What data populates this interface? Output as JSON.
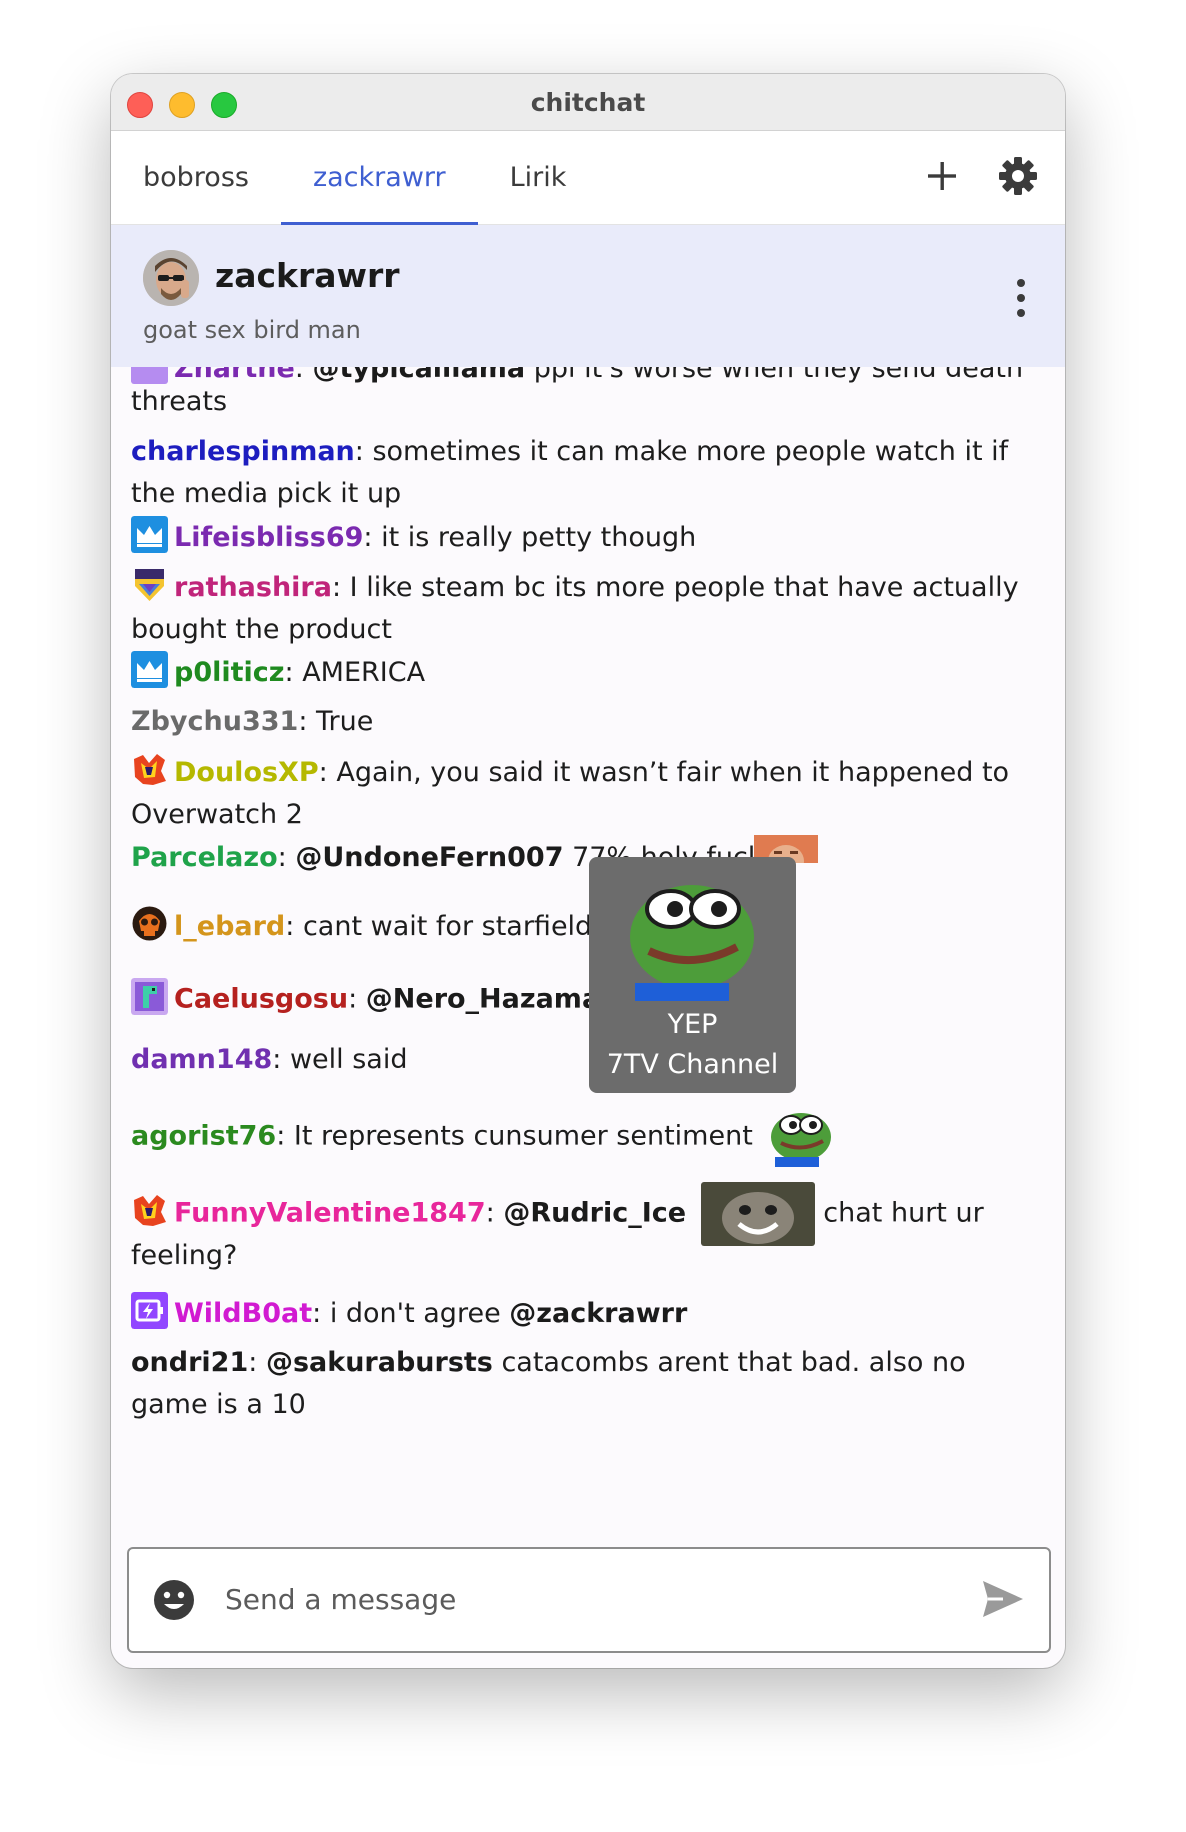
{
  "window": {
    "title": "chitchat"
  },
  "tabs": [
    {
      "label": "bobross",
      "active": false
    },
    {
      "label": "zackrawrr",
      "active": true
    },
    {
      "label": "Lirik",
      "active": false
    }
  ],
  "tab_actions": {
    "add_icon": "plus-icon",
    "settings_icon": "gear-icon"
  },
  "channel": {
    "name": "zackrawrr",
    "status": "goat sex bird man"
  },
  "messages": [
    {
      "user": "Znarthe",
      "sep": ":",
      "mention": "@typicalllama",
      "text": " ppl it's worse when they send death"
    },
    {
      "text": "threats"
    },
    {
      "user": "charlespinman",
      "sep": ":",
      "text": " sometimes it can make more people watch it if the media pick it up"
    },
    {
      "user": "Lifeisbliss69",
      "sep": ":",
      "text": " it is really petty though"
    },
    {
      "user": "rathashira",
      "sep": ":",
      "text": " I like steam bc its more people that have actually bought the product"
    },
    {
      "user": "p0liticz",
      "sep": ":",
      "text": " AMERICA"
    },
    {
      "user": "Zbychu331",
      "sep": ":",
      "text": " True"
    },
    {
      "user": "DoulosXP",
      "sep": ":",
      "text": " Again, you said it wasn’t fair when it happened to Overwatch 2"
    },
    {
      "user": "Parcelazo",
      "sep": ":",
      "mention": "@UndoneFern007",
      "text": " 77% holy fuck"
    },
    {
      "user": "l_ebard",
      "sep": ":",
      "text": " cant wait for starfield metacritic"
    },
    {
      "user": "Caelusgosu",
      "sep": ":",
      "mention": "@Nero_Hazama"
    },
    {
      "user": "damn148",
      "sep": ":",
      "text": " well said"
    },
    {
      "user": "agorist76",
      "sep": ":",
      "text": " It represents cunsumer sentiment"
    },
    {
      "user": "FunnyValentine1847",
      "sep": ":",
      "mention": "@Rudric_Ice",
      "text": " chat hurt ur",
      "text2": "feeling?"
    },
    {
      "user": "WildB0at",
      "sep": ":",
      "text": " i don't agree ",
      "mention_end": "@zackrawrr"
    },
    {
      "user": "ondri21",
      "sep": ":",
      "mention": "@sakurabursts",
      "text": " catacombs arent that bad. also no game is a 10"
    }
  ],
  "colors": {
    "accent": "#3f5fd1",
    "header_bg": "#e9ebfa",
    "charlespinman": "#1d1dbf",
    "Lifeisbliss69": "#7b2ab0",
    "rathashira": "#c0247a",
    "p0liticz": "#1f8a1f",
    "Zbychu331": "#6a6a6a",
    "DoulosXP": "#b5b800",
    "Parcelazo": "#1fa34a",
    "l_ebard": "#d4951c",
    "Caelusgosu": "#b5211f",
    "damn148": "#7030b0",
    "agorist76": "#2b8a1f",
    "FunnyValentine1847": "#e8269b",
    "WildB0at": "#d11ad1",
    "ondri21": "#1b1b1b"
  },
  "tooltip": {
    "emote": "YEP",
    "source": "7TV Channel"
  },
  "composer": {
    "placeholder": "Send a message",
    "emoji_icon": "smiley-icon",
    "send_icon": "send-arrow-icon"
  }
}
